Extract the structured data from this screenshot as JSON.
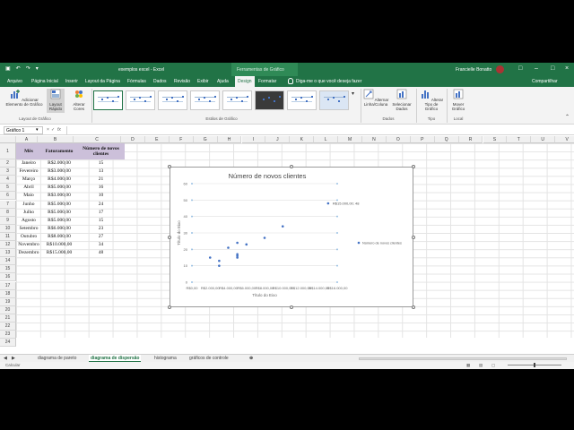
{
  "title_bar": {
    "title": "exemplos excel  -  Excel",
    "context_tab_group": "Ferramentas de Gráfico",
    "user": "Francielle Bonatto"
  },
  "tabs": [
    "Arquivo",
    "Página Inicial",
    "Inserir",
    "Layout da Página",
    "Fórmulas",
    "Dados",
    "Revisão",
    "Exibir",
    "Ajuda",
    "Design",
    "Formatar"
  ],
  "active_tab": "Design",
  "tell_me": "Diga-me o que você deseja fazer",
  "share": "Compartilhar",
  "ribbon": {
    "add_element": "Adicionar Elemento de Gráfico",
    "quick_layout": "Layout Rápido",
    "change_colors": "Alterar Cores",
    "switch_row_col": "Alternar Linha/Coluna",
    "select_data": "Selecionar Dados",
    "change_type": "Alterar Tipo de Gráfico",
    "move_chart": "Mover Gráfico",
    "group_layout": "Layout de Gráfico",
    "group_styles": "Estilos de Gráfico",
    "group_data": "Dados",
    "group_type": "Tipo",
    "group_location": "Local"
  },
  "name_box": "Gráfico 1",
  "fx": "fx",
  "columns": [
    "A",
    "B",
    "C",
    "D",
    "E",
    "F",
    "G",
    "H",
    "I",
    "J",
    "K",
    "L",
    "M",
    "N",
    "O",
    "P",
    "Q",
    "R",
    "S",
    "T",
    "U",
    "V"
  ],
  "rows": [
    "1",
    "2",
    "3",
    "4",
    "5",
    "6",
    "7",
    "8",
    "9",
    "10",
    "11",
    "12",
    "13",
    "14",
    "15",
    "16",
    "17",
    "18",
    "19",
    "20",
    "21",
    "22",
    "23",
    "24"
  ],
  "table": {
    "headers": [
      "Mês",
      "Faturamento",
      "Número de novos clientes"
    ],
    "data": [
      [
        "Janeiro",
        "R$2.000,00",
        "15"
      ],
      [
        "Fevereiro",
        "R$3.000,00",
        "13"
      ],
      [
        "Março",
        "R$4.000,00",
        "21"
      ],
      [
        "Abril",
        "R$5.000,00",
        "16"
      ],
      [
        "Maio",
        "R$3.000,00",
        "10"
      ],
      [
        "Junho",
        "R$5.000,00",
        "24"
      ],
      [
        "Julho",
        "R$5.000,00",
        "17"
      ],
      [
        "Agosto",
        "R$5.000,00",
        "15"
      ],
      [
        "Setembro",
        "R$6.000,00",
        "23"
      ],
      [
        "Outubro",
        "R$8.000,00",
        "27"
      ],
      [
        "Novembro",
        "R$10.000,00",
        "34"
      ],
      [
        "Dezembro",
        "R$15.000,00",
        "48"
      ]
    ]
  },
  "chart_data": {
    "type": "scatter",
    "title": "Número de novos clientes",
    "xlabel": "Título do Eixo",
    "ylabel": "Título do Eixo",
    "xlim": [
      0,
      16000
    ],
    "ylim": [
      0,
      60
    ],
    "x_ticks": [
      "R$0,00",
      "R$2.000,00",
      "R$4.000,00",
      "R$6.000,00",
      "R$8.000,00",
      "R$10.000,00",
      "R$12.000,00",
      "R$14.000,00",
      "R$16.000,00"
    ],
    "y_ticks": [
      "0",
      "10",
      "20",
      "30",
      "40",
      "50",
      "60"
    ],
    "grid": true,
    "legend_placement": "right",
    "series": [
      {
        "name": "Número de novos clientes",
        "x": [
          2000,
          3000,
          4000,
          5000,
          3000,
          5000,
          5000,
          5000,
          6000,
          8000,
          10000,
          15000
        ],
        "y": [
          15,
          13,
          21,
          16,
          10,
          24,
          17,
          15,
          23,
          27,
          34,
          48
        ]
      }
    ],
    "data_label": "R$15.000,00; 48",
    "color": "#4472c4"
  },
  "sheet_tabs": [
    "diagrama de pareto",
    "diagrama de dispersão",
    "histograma",
    "gráficos de controle"
  ],
  "active_sheet": "diagrama de dispersão",
  "status": "Calcular"
}
